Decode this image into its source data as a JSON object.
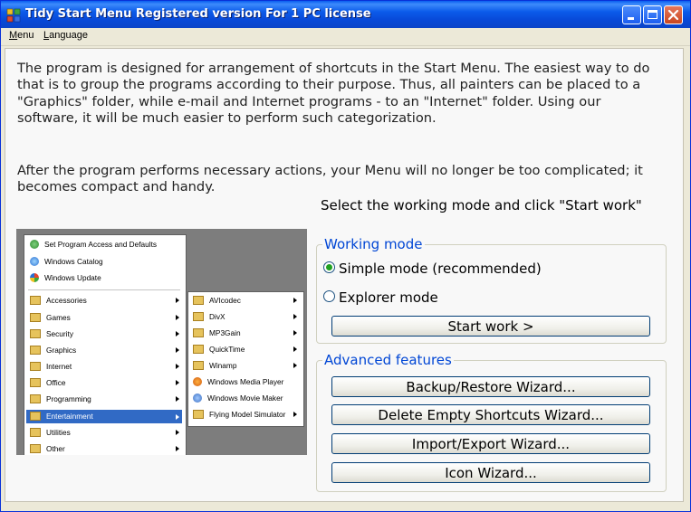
{
  "window": {
    "title": "Tidy Start Menu Registered version  For 1 PC license",
    "accent": "#0a5ef0",
    "icon": "app-grid-icon"
  },
  "menubar": {
    "items": [
      "Menu",
      "Language"
    ]
  },
  "content": {
    "intro": "The program is designed for arrangement of shortcuts in the Start Menu. The easiest way to do that is to group the programs according to their purpose. Thus, all painters can be placed to a \"Graphics\" folder, while e-mail and Internet programs - to an \"Internet\" folder. Using our software, it will be much easier to perform such categorization.",
    "outro": "After the program performs necessary actions, your Menu will no longer be too complicated; it becomes compact and handy.",
    "prompt": "Select the working mode and click \"Start work\""
  },
  "working_mode": {
    "title": "Working mode",
    "options": [
      {
        "label": "Simple mode (recommended)",
        "selected": true
      },
      {
        "label": "Explorer mode",
        "selected": false
      }
    ],
    "start_button": "Start work >"
  },
  "advanced": {
    "title": "Advanced features",
    "buttons": [
      "Backup/Restore Wizard...",
      "Delete Empty Shortcuts Wizard...",
      "Import/Export Wizard...",
      "Icon Wizard..."
    ]
  },
  "illustration": {
    "top_items": [
      "Set Program Access and Defaults",
      "Windows Catalog",
      "Windows Update"
    ],
    "folders": [
      "Accessories",
      "Games",
      "Security",
      "Graphics",
      "Internet",
      "Office",
      "Programming",
      "Entertainment",
      "Utilities",
      "Other"
    ],
    "submenu": [
      "AVIcodec",
      "DivX",
      "MP3Gain",
      "QuickTime",
      "Winamp",
      "Windows Media Player",
      "Windows Movie Maker",
      "Flying Model Simulator"
    ]
  }
}
